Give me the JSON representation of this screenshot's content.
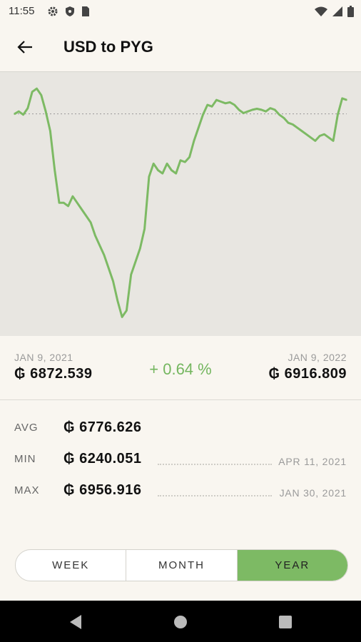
{
  "status": {
    "time": "11:55",
    "left_icons": [
      "settings-icon",
      "shield-icon",
      "sim-card-icon"
    ],
    "right_icons": [
      "wifi-icon",
      "signal-icon",
      "battery-icon"
    ]
  },
  "appbar": {
    "back_icon": "arrow-left-icon",
    "title": "USD to PYG"
  },
  "summary": {
    "start_date": "JAN 9, 2021",
    "start_value": "₲ 6872.539",
    "change": "+ 0.64 %",
    "end_date": "JAN 9, 2022",
    "end_value": "₲ 6916.809"
  },
  "stats": {
    "avg": {
      "label": "AVG",
      "value": "₲ 6776.626"
    },
    "min": {
      "label": "MIN",
      "value": "₲ 6240.051",
      "date": "APR 11, 2021"
    },
    "max": {
      "label": "MAX",
      "value": "₲ 6956.916",
      "date": "JAN 30, 2021"
    }
  },
  "periods": {
    "week": "WEEK",
    "month": "MONTH",
    "year": "YEAR",
    "selected": "YEAR"
  },
  "colors": {
    "accent": "#7dba64",
    "chart_bg": "#e8e6e1",
    "background": "#f9f6f0"
  },
  "chart_data": {
    "type": "line",
    "title": "",
    "xlabel": "",
    "ylabel": "",
    "x_start": "JAN 9, 2021",
    "x_end": "JAN 9, 2022",
    "ylim": [
      6240.051,
      6956.916
    ],
    "reference_value": 6872.539,
    "values": [
      6872,
      6880,
      6870,
      6890,
      6940,
      6950,
      6930,
      6880,
      6820,
      6700,
      6600,
      6600,
      6590,
      6620,
      6600,
      6580,
      6560,
      6540,
      6500,
      6470,
      6440,
      6400,
      6360,
      6300,
      6250,
      6270,
      6380,
      6420,
      6460,
      6520,
      6680,
      6720,
      6700,
      6690,
      6720,
      6700,
      6690,
      6730,
      6725,
      6740,
      6790,
      6830,
      6870,
      6900,
      6895,
      6915,
      6910,
      6905,
      6908,
      6900,
      6885,
      6875,
      6880,
      6885,
      6888,
      6885,
      6880,
      6890,
      6885,
      6870,
      6860,
      6845,
      6840,
      6830,
      6820,
      6810,
      6800,
      6790,
      6805,
      6810,
      6800,
      6790,
      6870,
      6920,
      6915
    ]
  }
}
